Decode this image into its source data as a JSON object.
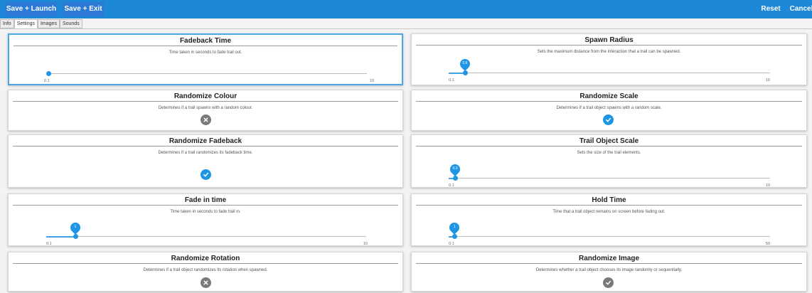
{
  "toolbar": {
    "save_launch": "Save + Launch",
    "save_exit": "Save + Exit",
    "reset": "Reset",
    "cancel": "Cancel"
  },
  "tabs": [
    "Info",
    "Settings",
    "Images",
    "Sounds"
  ],
  "active_tab": "Settings",
  "colors": {
    "accent": "#1f96e4",
    "topbar": "#1e88d8",
    "toggle_off": "#7a7a7a"
  },
  "settings": {
    "fadeback_time": {
      "title": "Fadeback Time",
      "description": "Time taken in seconds to fade trail out.",
      "min": "0.1",
      "max": "10",
      "value": 0.1
    },
    "spawn_radius": {
      "title": "Spawn Radius",
      "description": "Sets the maximum distance from the interaction that a trail can be spawned.",
      "min": "0.1",
      "max": "10",
      "value": 0.6,
      "value_label": "0.6"
    },
    "randomize_colour": {
      "title": "Randomize Colour",
      "description": "Determines if a trail spawns with a random colour.",
      "enabled": false
    },
    "randomize_scale": {
      "title": "Randomize Scale",
      "description": "Determines if a trail object spawns with a random scale.",
      "enabled": true
    },
    "randomize_fadeback": {
      "title": "Randomize Fadeback",
      "description": "Determines if a trail randomizes its fadeback time.",
      "enabled": true
    },
    "trail_object_scale": {
      "title": "Trail Object Scale",
      "description": "Sets the size of the trail elements.",
      "min": "0.1",
      "max": "10",
      "value": 0.3,
      "value_label": "0.3"
    },
    "fade_in_time": {
      "title": "Fade in time",
      "description": "Time taken in seconds to fade trail in.",
      "min": "0.1",
      "max": "10",
      "value": 1,
      "value_label": "1"
    },
    "hold_time": {
      "title": "Hold Time",
      "description": "Time that a trail object remains on screen before fading out.",
      "min": "0.1",
      "max": "50",
      "value": 1,
      "value_label": "1"
    },
    "randomize_rotation": {
      "title": "Randomize Rotation",
      "description": "Determines if a trail object randomizes its rotation when spawned.",
      "enabled": false
    },
    "randomize_image": {
      "title": "Randomize Image",
      "description": "Determines whether a trail object chooses its image randomly or sequentially.",
      "enabled": true,
      "disabled_style": true
    }
  }
}
